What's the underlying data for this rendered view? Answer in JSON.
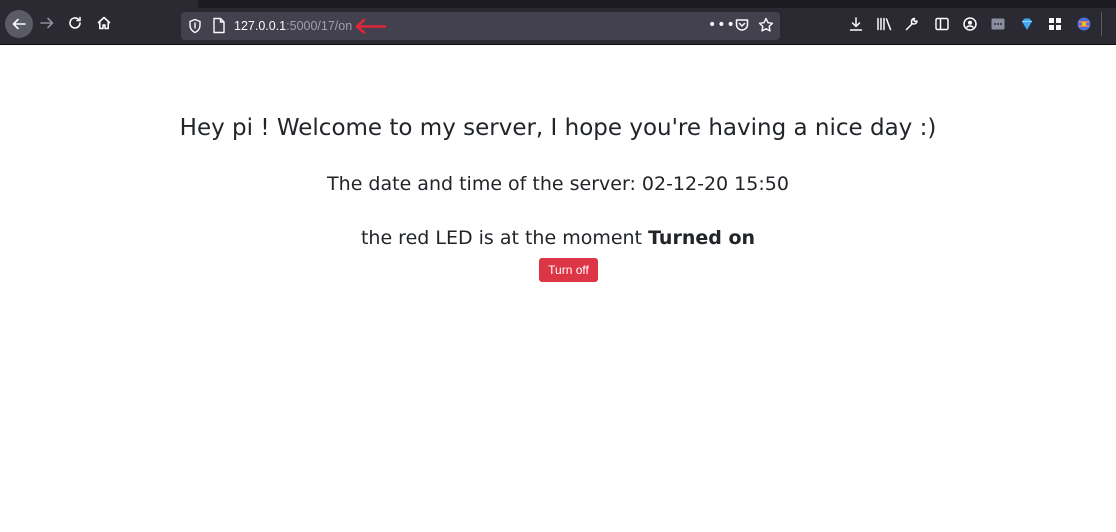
{
  "browser": {
    "url_host": "127.0.0.1",
    "url_path": ":5000/17/on",
    "more_label": "•••",
    "annotation_arrow_color": "#e0243a"
  },
  "page": {
    "welcome": "Hey pi ! Welcome to my server, I hope you're having a nice day :)",
    "datetime_label": "The date and time of the server: ",
    "datetime_value": "02-12-20 15:50",
    "led_label": "the red LED is at the moment ",
    "led_state": "Turned on",
    "button_label": "Turn off",
    "button_color": "#dc3545"
  }
}
